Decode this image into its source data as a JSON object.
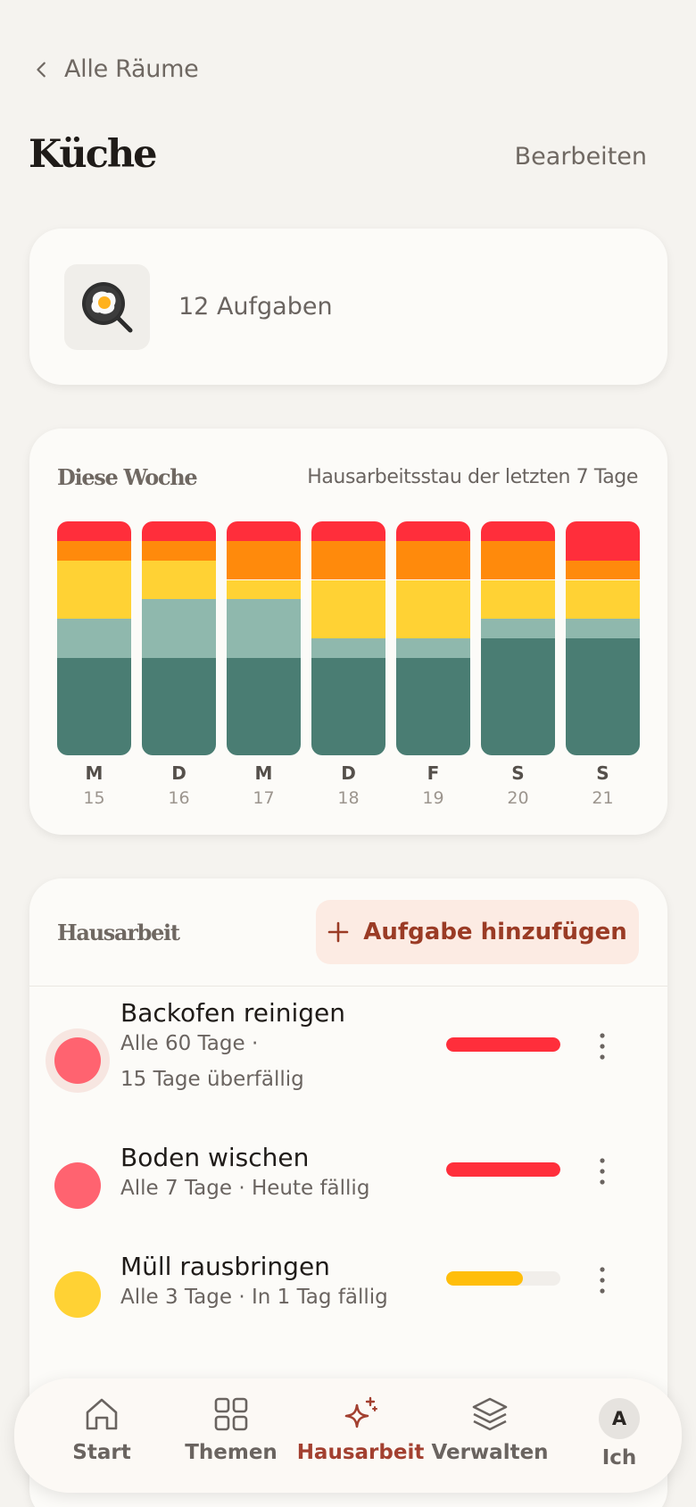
{
  "header": {
    "back_label": "Alle Räume",
    "title": "Küche",
    "edit_label": "Bearbeiten"
  },
  "room": {
    "icon": "frying-pan-egg-icon",
    "task_count_label": "12 Aufgaben"
  },
  "week": {
    "title": "Diese Woche",
    "subtitle": "Hausarbeitsstau der letzten 7 Tage",
    "colors": {
      "overdue": "#ff2e3b",
      "urgent": "#ff8a0c",
      "soon": "#ffd234",
      "ok": "#8fb8ad",
      "done": "#4a7d73"
    },
    "days": [
      {
        "letter": "M",
        "num": "15",
        "segments": [
          1,
          1,
          3,
          2,
          5
        ]
      },
      {
        "letter": "D",
        "num": "16",
        "segments": [
          1,
          1,
          2,
          3,
          5
        ]
      },
      {
        "letter": "M",
        "num": "17",
        "segments": [
          1,
          2,
          1,
          3,
          5
        ]
      },
      {
        "letter": "D",
        "num": "18",
        "segments": [
          1,
          2,
          3,
          1,
          5
        ]
      },
      {
        "letter": "F",
        "num": "19",
        "segments": [
          1,
          2,
          3,
          1,
          5
        ]
      },
      {
        "letter": "S",
        "num": "20",
        "segments": [
          1,
          2,
          2,
          1,
          6
        ]
      },
      {
        "letter": "S",
        "num": "21",
        "segments": [
          2,
          1,
          2,
          1,
          6
        ]
      }
    ]
  },
  "tasks": {
    "title": "Hausarbeit",
    "add_label": "Aufgabe hinzufügen",
    "items": [
      {
        "name": "Backofen reinigen",
        "interval": "Alle 60 Tage",
        "status": "15 Tage überfällig",
        "color": "#ff6370",
        "bar_color": "#ff2e3b",
        "progress": 1.0
      },
      {
        "name": "Boden wischen",
        "interval": "Alle 7 Tage",
        "status": "Heute fällig",
        "color": "#ff6370",
        "bar_color": "#ff2e3b",
        "progress": 1.0
      },
      {
        "name": "Müll rausbringen",
        "interval": "Alle 3 Tage",
        "status": "In 1 Tag fällig",
        "color": "#ffd234",
        "bar_color": "#ffbe0b",
        "progress": 0.67
      }
    ]
  },
  "nav": {
    "items": [
      {
        "label": "Start",
        "icon": "home-icon"
      },
      {
        "label": "Themen",
        "icon": "grid-icon"
      },
      {
        "label": "Hausarbeit",
        "icon": "sparkle-icon"
      },
      {
        "label": "Verwalten",
        "icon": "layers-icon"
      },
      {
        "label": "Ich",
        "icon": "avatar",
        "initial": "A"
      }
    ]
  }
}
